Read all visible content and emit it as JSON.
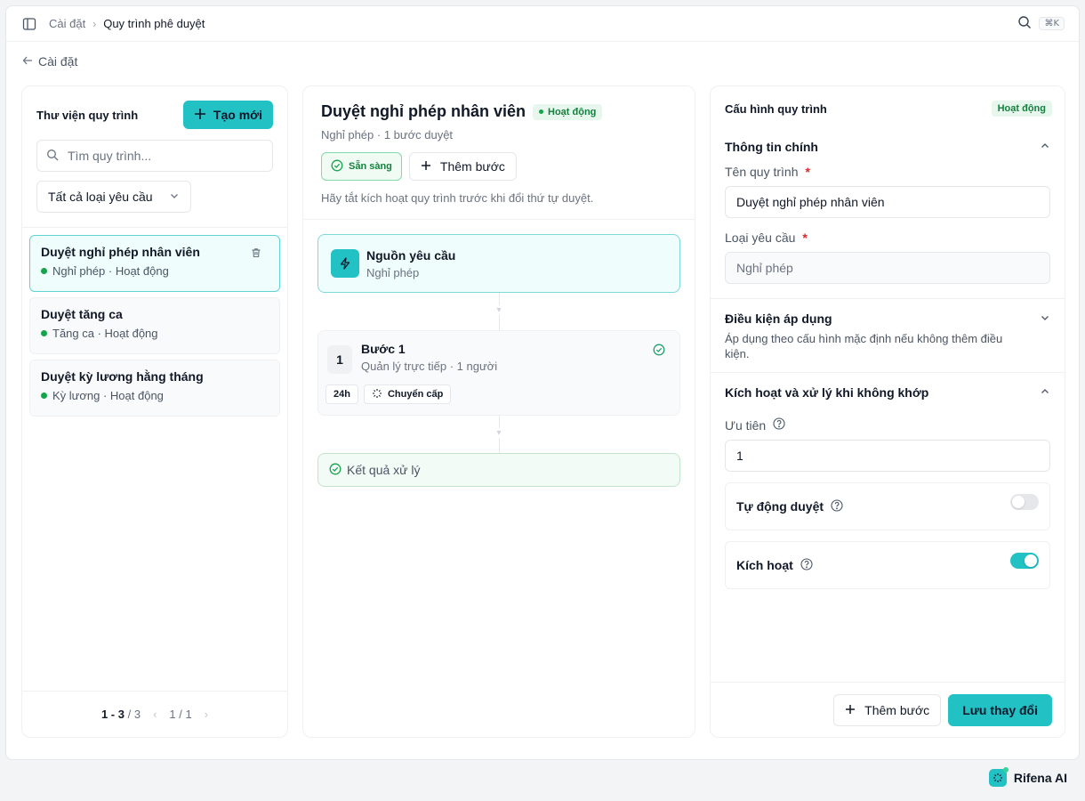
{
  "topbar": {
    "breadcrumb_parent": "Cài đặt",
    "breadcrumb_current": "Quy trình phê duyệt",
    "shortcut": "⌘K"
  },
  "back_label": "Cài đặt",
  "library": {
    "title": "Thư viện quy trình",
    "create_label": "Tạo mới",
    "search_placeholder": "Tìm quy trình...",
    "filter_label": "Tất cả loại yêu cầu",
    "items": [
      {
        "title": "Duyệt nghỉ phép nhân viên",
        "subtitle": "Nghỉ phép · Hoạt động"
      },
      {
        "title": "Duyệt tăng ca",
        "subtitle": "Tăng ca · Hoạt động"
      },
      {
        "title": "Duyệt kỳ lương hằng tháng",
        "subtitle": "Kỳ lương · Hoạt động"
      }
    ],
    "pagination": {
      "range": "1 - 3",
      "total": "/ 3",
      "page": "1 / 1"
    }
  },
  "workflow": {
    "title": "Duyệt nghỉ phép nhân viên",
    "status": "Hoạt động",
    "subtitle": "Nghỉ phép · 1 bước duyệt",
    "ready_label": "Sẵn sàng",
    "add_step_label": "Thêm bước",
    "hint": "Hãy tắt kích hoạt quy trình trước khi đổi thứ tự duyệt.",
    "source": {
      "title": "Nguồn yêu cầu",
      "subtitle": "Nghỉ phép"
    },
    "step": {
      "number": "1",
      "title": "Bước 1",
      "subtitle": "Quản lý trực tiếp · 1 người",
      "duration": "24h",
      "escalation": "Chuyển cấp"
    },
    "result_label": "Kết quả xử lý"
  },
  "config": {
    "title": "Cấu hình quy trình",
    "status": "Hoạt động",
    "main_info": {
      "title": "Thông tin chính",
      "name_label": "Tên quy trình",
      "name_value": "Duyệt nghỉ phép nhân viên",
      "type_label": "Loại yêu cầu",
      "type_value": "Nghỉ phép"
    },
    "conditions": {
      "title": "Điều kiện áp dụng",
      "description": "Áp dụng theo cấu hình mặc định nếu không thêm điều kiện."
    },
    "activation": {
      "title": "Kích hoạt và xử lý khi không khớp",
      "priority_label": "Ưu tiên",
      "priority_value": "1",
      "auto_approve_label": "Tự động duyệt",
      "auto_approve_on": false,
      "active_label": "Kích hoạt",
      "active_on": true
    },
    "add_step_label": "Thêm bước",
    "save_label": "Lưu thay đổi"
  },
  "brand": "Rifena AI",
  "colors": {
    "accent": "#22c1c3",
    "success": "#16a34a"
  }
}
